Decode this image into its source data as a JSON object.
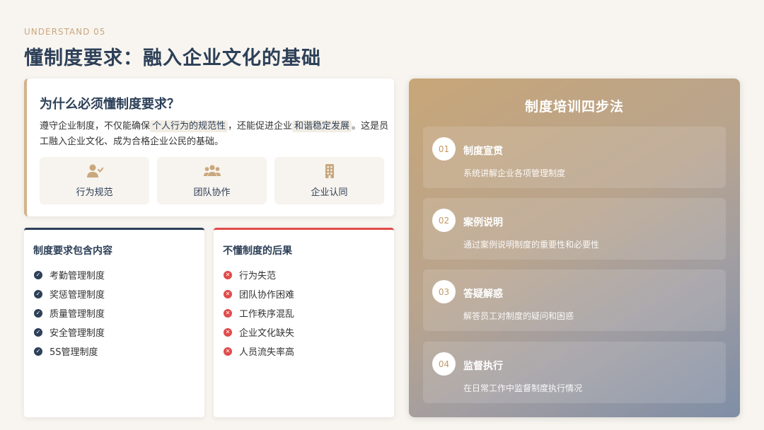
{
  "header": {
    "eyebrow": "UNDERSTAND 05",
    "title": "懂制度要求：融入企业文化的基础"
  },
  "why": {
    "title": "为什么必须懂制度要求？",
    "desc_1": "遵守企业制度，不仅能确保",
    "highlight_1": "个人行为的规范性",
    "desc_2": "，还能促进企业",
    "highlight_2": "和谐稳定发展",
    "desc_3": "。这是员工融入企业文化、成为合格企业公民的基础。",
    "tags": [
      {
        "label": "行为规范",
        "icon": "user-check-icon"
      },
      {
        "label": "团队协作",
        "icon": "users-icon"
      },
      {
        "label": "企业认同",
        "icon": "building-icon"
      }
    ]
  },
  "contents_card": {
    "title": "制度要求包含内容",
    "items": [
      "考勤管理制度",
      "奖惩管理制度",
      "质量管理制度",
      "安全管理制度",
      "5S管理制度"
    ]
  },
  "consequences_card": {
    "title": "不懂制度的后果",
    "items": [
      "行为失范",
      "团队协作困难",
      "工作秩序混乱",
      "企业文化缺失",
      "人员流失率高"
    ]
  },
  "method": {
    "title": "制度培训四步法",
    "steps": [
      {
        "num": "01",
        "title": "制度宣贯",
        "desc": "系统讲解企业各项管理制度"
      },
      {
        "num": "02",
        "title": "案例说明",
        "desc": "通过案例说明制度的重要性和必要性"
      },
      {
        "num": "03",
        "title": "答疑解惑",
        "desc": "解答员工对制度的疑问和困惑"
      },
      {
        "num": "04",
        "title": "监督执行",
        "desc": "在日常工作中监督制度执行情况"
      }
    ]
  },
  "colors": {
    "navy": "#2d4058",
    "gold": "#c9a77c",
    "red": "#e14b4b"
  }
}
